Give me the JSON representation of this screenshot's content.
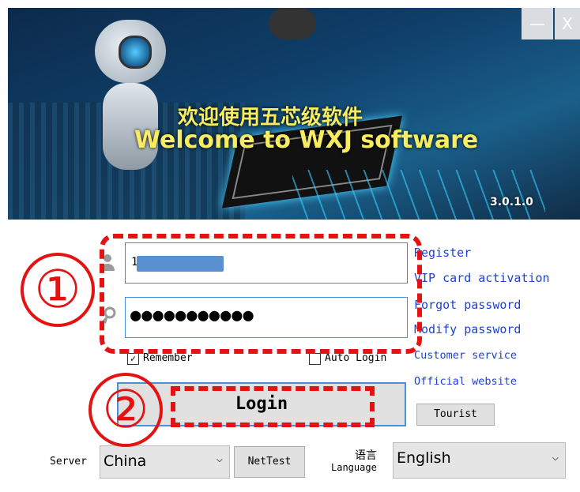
{
  "window": {
    "minimize_label": "—",
    "close_label": "X"
  },
  "banner": {
    "title_cn": "欢迎使用五芯级软件",
    "title_en": "Welcome to WXJ software",
    "version": "3.0.1.0"
  },
  "login": {
    "username_value": "1",
    "password_value": "●●●●●●●●●●●",
    "remember_label": "Remember",
    "remember_checked": true,
    "auto_login_label": "Auto Login",
    "auto_login_checked": false,
    "login_label": "Login",
    "tourist_label": "Tourist"
  },
  "links": {
    "register": "Register",
    "vip": "VIP card activation",
    "forgot": "Forgot password",
    "modify": "Modify password",
    "customer": "Customer service",
    "official": "Official website"
  },
  "footer": {
    "server_label": "Server",
    "server_value": "China",
    "nettest_label": "NetTest",
    "language_cn": "语言",
    "language_label": "Language",
    "language_value": "English"
  },
  "annotations": {
    "marker1": "①",
    "marker2": "②"
  },
  "colors": {
    "annotation": "#e51212",
    "link": "#1d3fd6",
    "title": "#f7ec62"
  }
}
